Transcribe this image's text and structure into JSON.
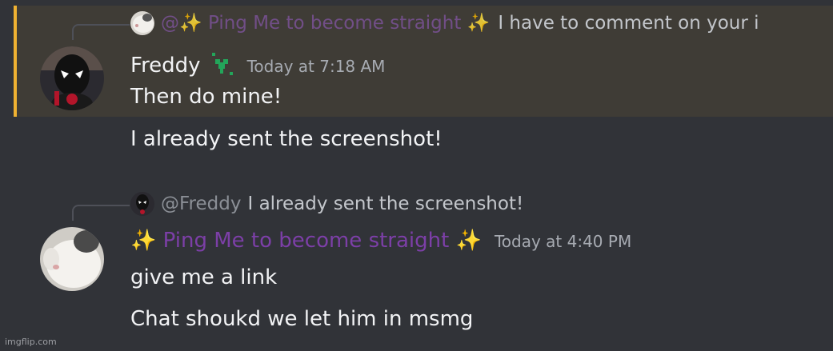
{
  "messages": [
    {
      "reply": {
        "mention": "@✨ Ping Me to become straight ✨",
        "text": "I have to comment on your i",
        "avatar": "cat-avatar"
      },
      "author": "Freddy",
      "author_badge": "plant-badge-icon",
      "timestamp": "Today at 7:18 AM",
      "lines": [
        "Then do mine!",
        "I already sent the screenshot!"
      ],
      "highlighted": true,
      "avatar": "spider-man-avatar"
    },
    {
      "reply": {
        "mention": "@Freddy",
        "text": "I already sent the screenshot!",
        "avatar": "spider-man-avatar"
      },
      "author": "✨ Ping Me to become straight ✨",
      "timestamp": "Today at 4:40 PM",
      "lines": [
        "give me a link",
        "Chat shoukd we let him in msmg"
      ],
      "highlighted": false,
      "avatar": "cat-avatar"
    }
  ],
  "colors": {
    "background": "#313338",
    "highlight": "#3f3c36",
    "highlight_bar": "#f0b232",
    "role_purple": "#7c3fa7"
  },
  "watermark": "imgflip.com"
}
